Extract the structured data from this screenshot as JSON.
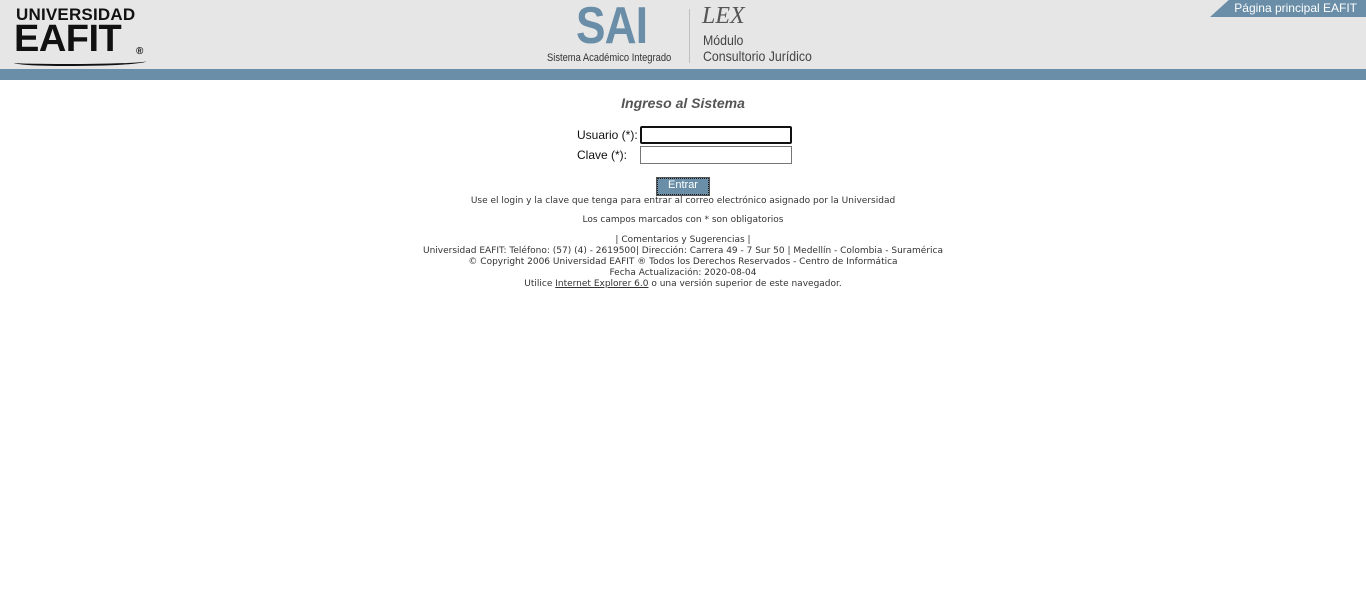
{
  "header": {
    "eafit_logo": {
      "line1": "UNIVERSIDAD",
      "line2": "EAFIT",
      "reg": "®"
    },
    "sai_logo": {
      "big": "SAI",
      "sub": "Sistema Académico Integrado"
    },
    "lex_logo": {
      "lex": "LEX",
      "line1": "Módulo",
      "line2": "Consultorio Jurídico"
    },
    "home_link": "Página principal EAFIT"
  },
  "login": {
    "title": "Ingreso al Sistema",
    "user_label": "Usuario (*):",
    "user_value": "",
    "password_label": "Clave (*):",
    "password_value": "",
    "submit_label": "Entrar",
    "help_text": "Use el login y la clave que tenga para entrar al correo electrónico asignado por la Universidad",
    "required_note": "Los campos marcados con * son obligatorios"
  },
  "footer": {
    "comments_prefix": "| ",
    "comments_link": "Comentarios y Sugerencias",
    "comments_suffix": " |",
    "contact": "Universidad EAFIT: Teléfono: (57) (4) - 2619500| Dirección: Carrera 49 - 7 Sur 50 | Medellín - Colombia - Suramérica",
    "copyright": "© Copyright 2006 Universidad EAFIT ® Todos los Derechos Reservados - Centro de Informática",
    "updated": "Fecha Actualización: 2020-08-04",
    "browser_prefix": "Utilice ",
    "browser_link": "Internet Explorer 6.0",
    "browser_suffix": " o una versión superior de este navegador."
  },
  "colors": {
    "accent": "#6a8ea8",
    "header_bg": "#e6e6e6"
  }
}
